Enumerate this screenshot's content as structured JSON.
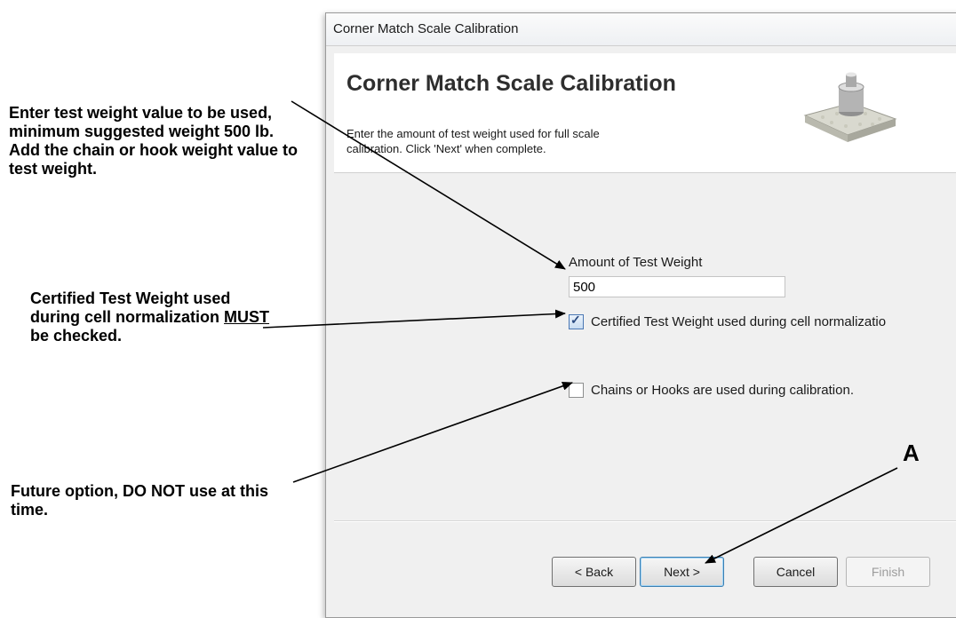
{
  "window": {
    "title": "Corner Match Scale Calibration"
  },
  "wizard": {
    "heading": "Corner Match Scale Calibration",
    "description": "Enter the amount of test weight used for full scale calibration. Click 'Next' when complete.",
    "icon": "scale-platform-icon"
  },
  "form": {
    "test_weight_label": "Amount of Test Weight",
    "test_weight_value": "500",
    "certified_label": "Certified Test Weight used during cell normalizatio",
    "certified_checked": true,
    "chains_label": "Chains or Hooks are used during calibration.",
    "chains_checked": false
  },
  "buttons": {
    "back": "< Back",
    "next": "Next >",
    "cancel": "Cancel",
    "finish": "Finish"
  },
  "callouts": {
    "test_weight": "Enter test weight value to be used, minimum suggested weight 500 lb. Add the chain or hook weight value to test weight.",
    "certified_pre": "Certified Test Weight used during cell normalization ",
    "certified_emph": "MUST",
    "certified_post": " be checked.",
    "chains": "Future option, DO NOT use at this time.",
    "label_a": "A"
  },
  "colors": {
    "background": "#ffffff",
    "dialog_bg": "#f0f0f0",
    "header_bg": "#ffffff",
    "arrow": "#000000"
  }
}
